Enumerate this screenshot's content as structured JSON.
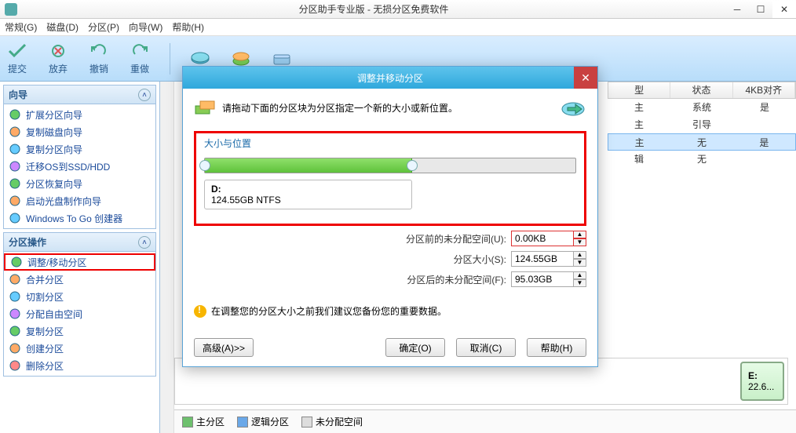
{
  "window": {
    "title": "分区助手专业版 - 无损分区免费软件"
  },
  "menu": {
    "general": "常规(G)",
    "disk": "磁盘(D)",
    "partition": "分区(P)",
    "wizard": "向导(W)",
    "help": "帮助(H)"
  },
  "toolbar": {
    "commit": "提交",
    "discard": "放弃",
    "undo": "撤销",
    "redo": "重做"
  },
  "sidebar": {
    "wizard_title": "向导",
    "wizard_items": [
      "扩展分区向导",
      "复制磁盘向导",
      "复制分区向导",
      "迁移OS到SSD/HDD",
      "分区恢复向导",
      "启动光盘制作向导",
      "Windows To Go 创建器"
    ],
    "ops_title": "分区操作",
    "ops_items": [
      "调整/移动分区",
      "合并分区",
      "切割分区",
      "分配自由空间",
      "复制分区",
      "创建分区",
      "删除分区"
    ]
  },
  "right_table": {
    "headers": [
      "型",
      "状态",
      "4KB对齐"
    ],
    "rows": [
      {
        "c1": "主",
        "c2": "系统",
        "c3": "是"
      },
      {
        "c1": "主",
        "c2": "引导",
        "c3": ""
      },
      {
        "c1": "主",
        "c2": "无",
        "c3": "是"
      },
      {
        "c1": "辑",
        "c2": "无",
        "c3": ""
      }
    ],
    "sel_index": 2
  },
  "partbar": {
    "e_label": "E:",
    "e_size": "22.6..."
  },
  "legend": {
    "primary": "主分区",
    "logical": "逻辑分区",
    "unalloc": "未分配空间"
  },
  "dialog": {
    "title": "调整并移动分区",
    "instruction": "请拖动下面的分区块为分区指定一个新的大小或新位置。",
    "group_label": "大小与位置",
    "drive_letter": "D:",
    "drive_info": "124.55GB NTFS",
    "field_before": "分区前的未分配空间(U):",
    "val_before": "0.00KB",
    "field_size": "分区大小(S):",
    "val_size": "124.55GB",
    "field_after": "分区后的未分配空间(F):",
    "val_after": "95.03GB",
    "warning": "在调整您的分区大小之前我们建议您备份您的重要数据。",
    "advanced": "高级(A)>>",
    "ok": "确定(O)",
    "cancel": "取消(C)",
    "help": "帮助(H)"
  }
}
